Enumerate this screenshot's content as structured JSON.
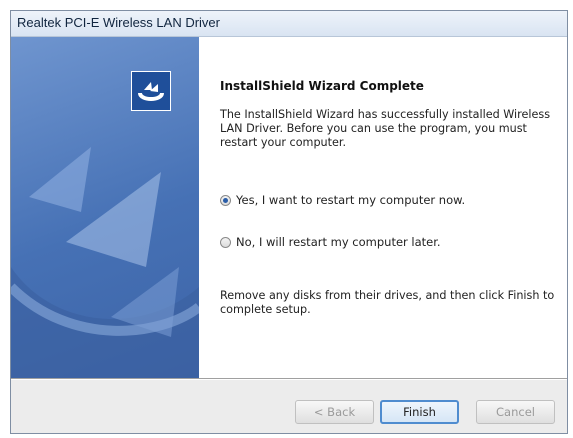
{
  "window": {
    "title": "Realtek PCI-E Wireless LAN Driver"
  },
  "side_panel": {
    "logo_icon": "installshield-logo-icon",
    "colors": {
      "panel_blue": "#4671b5",
      "logo_blue": "#1f4f9a"
    }
  },
  "content": {
    "heading": "InstallShield Wizard Complete",
    "intro": "The InstallShield Wizard has successfully installed Wireless LAN Driver.  Before you can use the program, you must restart your computer.",
    "options": [
      {
        "label": "Yes, I want to restart my computer now.",
        "selected": true
      },
      {
        "label": "No, I will restart my computer later.",
        "selected": false
      }
    ],
    "outro": "Remove any disks from their drives, and then click Finish to complete setup."
  },
  "buttons": {
    "back": "< Back",
    "finish": "Finish",
    "cancel": "Cancel"
  }
}
